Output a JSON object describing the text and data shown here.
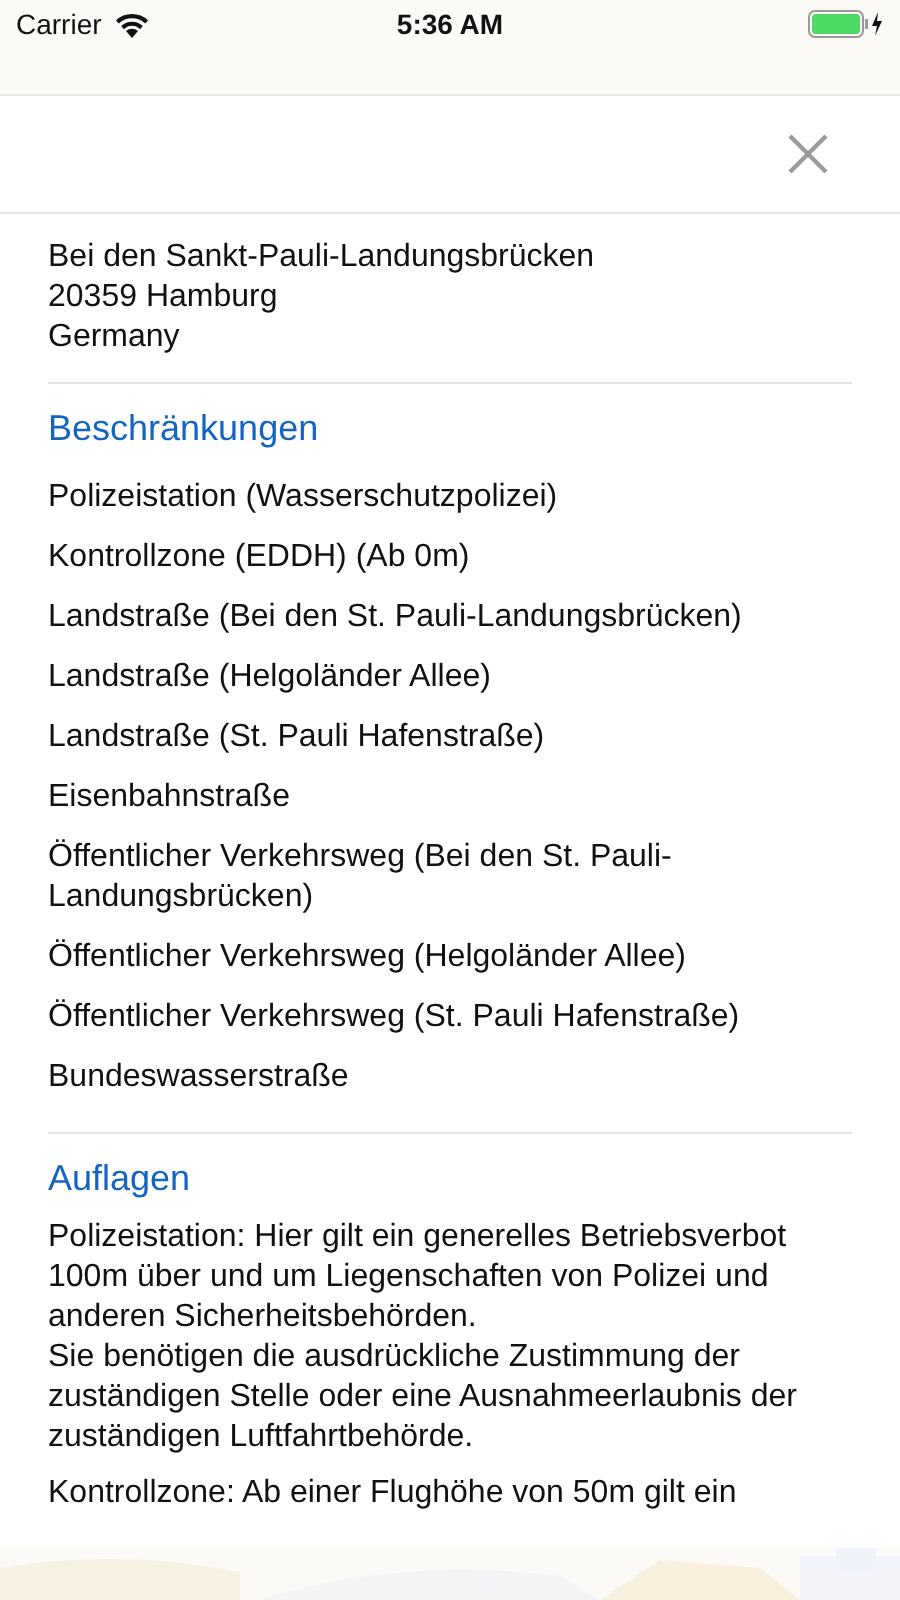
{
  "status_bar": {
    "carrier": "Carrier",
    "time": "5:36 AM"
  },
  "address": [
    "Bei den Sankt-Pauli-Landungsbrücken",
    "20359 Hamburg",
    "Germany"
  ],
  "restrictions": {
    "title": "Beschränkungen",
    "items": [
      "Polizeistation (Wasserschutzpolizei)",
      "Kontrollzone (EDDH) (Ab 0m)",
      "Landstraße (Bei den St. Pauli-Landungsbrücken)",
      "Landstraße (Helgoländer Allee)",
      "Landstraße (St. Pauli Hafenstraße)",
      "Eisenbahnstraße",
      "Öffentlicher Verkehrsweg (Bei den St. Pauli-Landungsbrücken)",
      "Öffentlicher Verkehrsweg (Helgoländer Allee)",
      "Öffentlicher Verkehrsweg (St. Pauli Hafenstraße)",
      "Bundeswasserstraße"
    ]
  },
  "conditions": {
    "title": "Auflagen",
    "paragraphs": [
      "Polizeistation: Hier gilt ein generelles Betriebsverbot 100m über und um Liegenschaften von Polizei und anderen Sicherheitsbehörden.\nSie benötigen die ausdrückliche Zustimmung der zuständigen Stelle oder eine Ausnahmeerlaubnis der zuständigen Luftfahrtbehörde.",
      "Kontrollzone: Ab einer Flughöhe von 50m gilt ein"
    ]
  }
}
